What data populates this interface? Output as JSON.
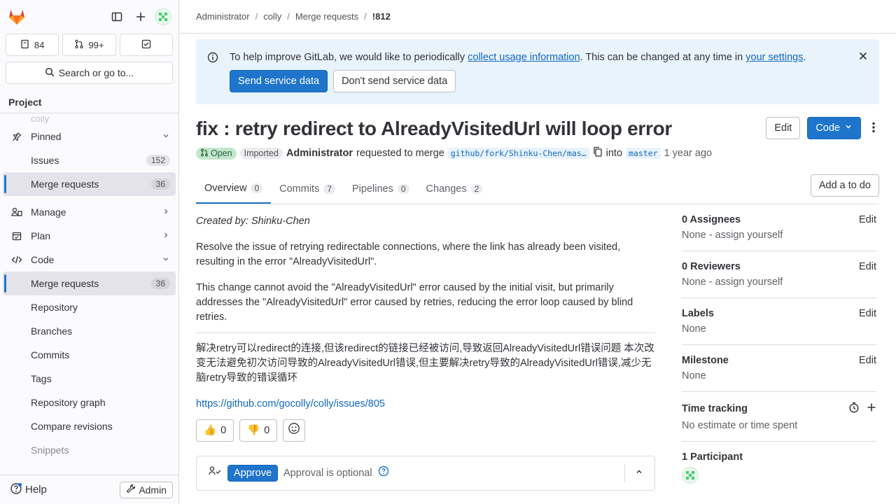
{
  "sidebar": {
    "counters": {
      "issues": "84",
      "merge_requests": "99+"
    },
    "search_label": "Search or go to...",
    "section_label": "Project",
    "project_ghost": "colly",
    "pinned_label": "Pinned",
    "pinned_items": [
      {
        "label": "Issues",
        "count": "152"
      },
      {
        "label": "Merge requests",
        "count": "36"
      }
    ],
    "manage_label": "Manage",
    "plan_label": "Plan",
    "code_label": "Code",
    "code_items": [
      {
        "label": "Merge requests",
        "count": "36"
      },
      {
        "label": "Repository"
      },
      {
        "label": "Branches"
      },
      {
        "label": "Commits"
      },
      {
        "label": "Tags"
      },
      {
        "label": "Repository graph"
      },
      {
        "label": "Compare revisions"
      },
      {
        "label": "Snippets"
      }
    ],
    "help_label": "Help",
    "admin_label": "Admin"
  },
  "breadcrumb": [
    "Administrator",
    "colly",
    "Merge requests",
    "!812"
  ],
  "banner": {
    "text_before": "To help improve GitLab, we would like to periodically ",
    "link1": "collect usage information",
    "text_middle": ". This can be changed at any time in ",
    "link2": "your settings",
    "text_after": ".",
    "send_label": "Send service data",
    "dont_send_label": "Don't send service data"
  },
  "mr": {
    "title": "fix : retry redirect to AlreadyVisitedUrl will loop error",
    "edit_label": "Edit",
    "code_label": "Code",
    "status": "Open",
    "imported": "Imported",
    "author": "Administrator",
    "requested_text": "requested to merge",
    "source_branch": "github/fork/Shinku-Chen/mas…",
    "into_text": "into",
    "target_branch": "master",
    "time": "1 year ago"
  },
  "tabs": [
    {
      "label": "Overview",
      "count": "0"
    },
    {
      "label": "Commits",
      "count": "7"
    },
    {
      "label": "Pipelines",
      "count": "0"
    },
    {
      "label": "Changes",
      "count": "2"
    }
  ],
  "todo_label": "Add a to do",
  "description": {
    "created_by": "Created by: Shinku-Chen",
    "p1": "Resolve the issue of retrying redirectable connections, where the link has already been visited, resulting in the error \"AlreadyVisitedUrl\".",
    "p2": "This change cannot avoid the \"AlreadyVisitedUrl\" error caused by the initial visit, but primarily addresses the \"AlreadyVisitedUrl\" error caused by retries, reducing the error loop caused by blind retries.",
    "p3": "解决retry可以redirect的连接,但该redirect的链接已经被访问,导致返回AlreadyVisitedUrl错误问题 本次改变无法避免初次访问导致的AlreadyVisitedUrl错误,但主要解决retry导致的AlreadyVisitedUrl错误,减少无脑retry导致的错误循环",
    "link": "https://github.com/gocolly/colly/issues/805"
  },
  "reactions": {
    "thumbs_up": "0",
    "thumbs_down": "0"
  },
  "approval": {
    "approve_label": "Approve",
    "optional_text": "Approval is optional"
  },
  "right_sidebar": {
    "assignees": {
      "title": "0 Assignees",
      "edit": "Edit",
      "value": "None - assign yourself"
    },
    "reviewers": {
      "title": "0 Reviewers",
      "edit": "Edit",
      "value": "None - assign yourself"
    },
    "labels": {
      "title": "Labels",
      "edit": "Edit",
      "value": "None"
    },
    "milestone": {
      "title": "Milestone",
      "edit": "Edit",
      "value": "None"
    },
    "time_tracking": {
      "title": "Time tracking",
      "value": "No estimate or time spent"
    },
    "participants": {
      "title": "1 Participant"
    }
  },
  "colors": {
    "accent": "#1f75cb",
    "open_bg": "#c3e6cd",
    "banner_bg": "#e9f3fc",
    "brand": "#e24329"
  }
}
